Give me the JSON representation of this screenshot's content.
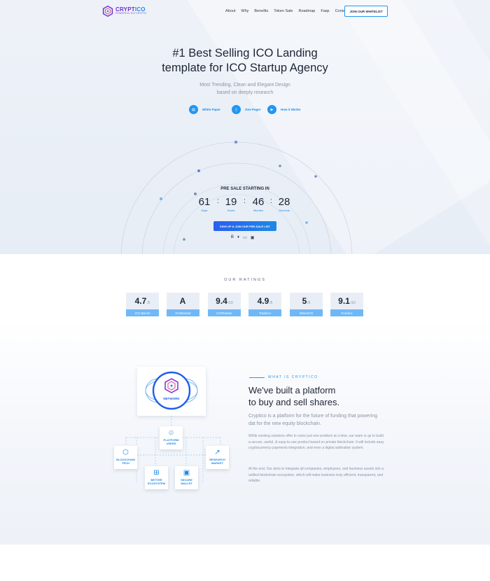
{
  "header": {
    "logo_name_a": "CRYPT",
    "logo_name_b": "ICO",
    "logo_tag": "POWERFUL ICO CRYPTO",
    "menu": [
      "About",
      "Why",
      "Benefits",
      "Token Sale",
      "Roadmap",
      "Faqs",
      "Contact"
    ],
    "cta": "JOIN OUR WHITELIST"
  },
  "hero": {
    "title_line1": "#1 Best Selling ICO Landing",
    "title_line2": "template for ICO Startup Agency",
    "subtitle_line1": "Most Trending, Clean and Elegant Design",
    "subtitle_line2": "based on deeply research",
    "links": [
      {
        "label": "White Paper",
        "icon": "document-icon"
      },
      {
        "label": "One Pager",
        "icon": "file-icon"
      },
      {
        "label": "How it Works",
        "icon": "play-icon"
      }
    ],
    "presale_label": "PRE SALE STARTING IN",
    "countdown": [
      {
        "value": "61",
        "label": "Days"
      },
      {
        "value": "19",
        "label": "Hours"
      },
      {
        "value": "46",
        "label": "Minutes"
      },
      {
        "value": "28",
        "label": "Seconds"
      }
    ],
    "signup": "SIGN UP & JOIN OUR PRE-SALE LIST",
    "payments": [
      "bitcoin-icon",
      "ethereum-icon",
      "card-icon",
      "wallet-icon"
    ],
    "payment_glyphs": [
      "Ƀ",
      "♦",
      "▭",
      "▣"
    ]
  },
  "ratings": {
    "title": "OUR RATINGS",
    "items": [
      {
        "value": "4.7",
        "unit": "/5",
        "source": "ICO Bench"
      },
      {
        "value": "A",
        "unit": "",
        "source": "ICOBazaar"
      },
      {
        "value": "9.4",
        "unit": "/10",
        "source": "ICORanker"
      },
      {
        "value": "4.9",
        "unit": "/5",
        "source": "Tradeico"
      },
      {
        "value": "5",
        "unit": "/5",
        "source": "WiserICO"
      },
      {
        "value": "9.1",
        "unit": "/10",
        "source": "Fundico"
      }
    ]
  },
  "about": {
    "eyebrow": "WHAT IS CRYPTICO",
    "heading_line1": "We've built a platform",
    "heading_line2": "to buy and sell shares.",
    "lead": "Cryptico is a platform for the future of funding that powering dat for the new equity blockchain.",
    "para1": "While existing solutions offer to solve just one problem at a time, our team is up to build a secure, useful, & easy-to-use product based on private blockchain. It will include easy cryptocurrency payments integration, and even a digital arbitration system.",
    "para2": "At the end, Our aims to integrate all companies, employees, and business assets into a unified blockchain ecosystem, which will make business truly efficient, transparent, and reliable.",
    "diagram": {
      "center": "NETWORK",
      "nodes": [
        {
          "label": "PLATFORM USERS",
          "icon": "users-icon"
        },
        {
          "label": "BLOCKCHAIN TECH",
          "icon": "blockchain-icon"
        },
        {
          "label": "RESEARCH MARKET",
          "icon": "chart-icon"
        },
        {
          "label": "BETTER ECOSYSTEM",
          "icon": "ecosystem-icon"
        },
        {
          "label": "SECURE WALLET",
          "icon": "wallet-icon"
        }
      ]
    }
  },
  "colors": {
    "accent": "#2196f3",
    "brand_purple": "#6b2fd1",
    "rating_bar": "#6fb8f7"
  }
}
